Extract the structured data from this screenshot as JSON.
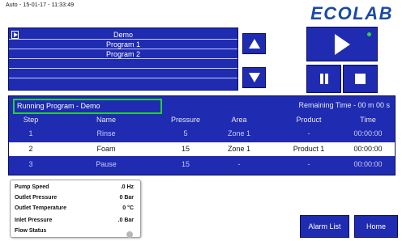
{
  "header": {
    "timestamp": "Auto - 15-01-17 - 11:33:49",
    "logo_text": "ECOLAB"
  },
  "program_list": {
    "items": [
      "Demo",
      "Program 1",
      "Program 2",
      "",
      "",
      ""
    ]
  },
  "running": {
    "label": "Running Program - Demo",
    "remaining": "Remaining Time - 00 m 00 s",
    "columns": [
      "Step",
      "Name",
      "Pressure",
      "Area",
      "Product",
      "Time"
    ],
    "rows": [
      {
        "step": "1",
        "name": "Rinse",
        "pressure": "5",
        "area": "Zone 1",
        "product": "-",
        "time": "00:00:00"
      },
      {
        "step": "2",
        "name": "Foam",
        "pressure": "15",
        "area": "Zone 1",
        "product": "Product 1",
        "time": "00:00:00"
      },
      {
        "step": "3",
        "name": "Pause",
        "pressure": "15",
        "area": "-",
        "product": "-",
        "time": "00:00:00"
      }
    ]
  },
  "status": {
    "pump_speed_label": "Pump Speed",
    "pump_speed_value": ".0 Hz",
    "outlet_pressure_label": "Outlet Pressure",
    "outlet_pressure_value": "0 Bar",
    "outlet_temperature_label": "Outlet Temperature",
    "outlet_temperature_value": "0 °C",
    "inlet_pressure_label": "Inlet Pressure",
    "inlet_pressure_value": ".0 Bar",
    "flow_status_label": "Flow Status"
  },
  "buttons": {
    "alarm_list": "Alarm List",
    "home": "Home"
  },
  "colors": {
    "panel_blue": "#1f2bb0",
    "highlight_green": "#22d13a",
    "logo_blue": "#1a49a8",
    "indicator_green": "#33d23a",
    "status_dot_grey": "#b8b8b8"
  },
  "icons": [
    "play-icon",
    "pause-icon",
    "stop-icon",
    "arrow-up-icon",
    "arrow-down-icon",
    "selection-marker-icon",
    "status-indicator-icon"
  ]
}
